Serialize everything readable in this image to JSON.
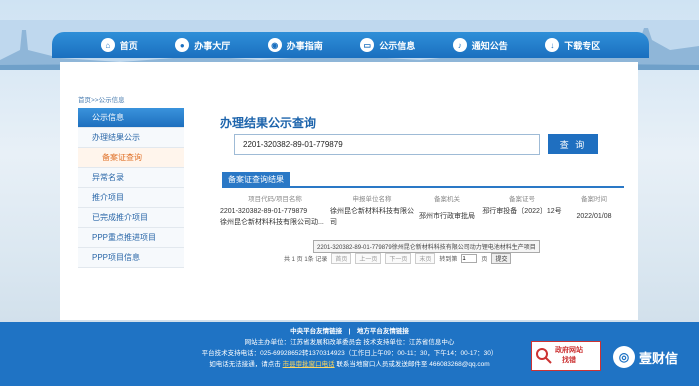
{
  "nav": [
    {
      "label": "首页",
      "icon": "home-icon"
    },
    {
      "label": "办事大厅",
      "icon": "user-icon"
    },
    {
      "label": "办事指南",
      "icon": "guide-icon"
    },
    {
      "label": "公示信息",
      "icon": "display-icon"
    },
    {
      "label": "通知公告",
      "icon": "bell-icon"
    },
    {
      "label": "下载专区",
      "icon": "download-icon"
    }
  ],
  "breadcrumb": "首页>>公示信息",
  "sidebar": {
    "items": [
      {
        "label": "公示信息"
      },
      {
        "label": "办理结果公示"
      },
      {
        "label": "备案证查询"
      },
      {
        "label": "异常名录"
      },
      {
        "label": "推介项目"
      },
      {
        "label": "已完成推介项目"
      },
      {
        "label": "PPP重点推进项目"
      },
      {
        "label": "PPP项目信息"
      }
    ]
  },
  "main": {
    "title": "办理结果公示查询",
    "search_value": "2201-320382-89-01-779879",
    "search_button": "查 询",
    "result_tab": "备案证查询结果",
    "columns": [
      "项目代码/项目名称",
      "申报单位名称",
      "备案机关",
      "备案证号",
      "备案时间"
    ],
    "row": {
      "code": "2201-320382-89-01-779879",
      "name": "徐州昆仑新材料科技有限公司动...",
      "unit": "徐州昆仑新材料科技有限公司",
      "agency": "邳州市行政审批局",
      "cert": "邳行审投备〔2022〕12号",
      "date": "2022/01/08"
    },
    "tooltip": "2201-320382-89-01-779879徐州昆仑新材料科技有限公司动力锂电池材料生产项目",
    "pager": {
      "info": "共 1 页 1条 记录",
      "first": "首页",
      "prev": "上一页",
      "next": "下一页",
      "last": "末页",
      "goto_label": "转到第",
      "page_value": "1",
      "page_suffix": "页",
      "submit": "提交"
    }
  },
  "footer": {
    "links": "中央平台友情链接　|　地方平台友情链接",
    "line1": "网站主办单位：江苏省发展和改革委员会 技术支持单位：江苏省信息中心",
    "line2": "平台技术支持电话：025-69928652转1370314923（工作日上午09：00-11：30，下午14：00-17：30）",
    "line3_pre": "如电话无法接通，请点击",
    "line3_link": "市县审批窗口电话",
    "line3_post": "联系当地窗口人员或发送邮件至 466083268@qq.com",
    "badge_line1": "政府网站",
    "badge_line2": "找错"
  },
  "watermark": "壹财信"
}
